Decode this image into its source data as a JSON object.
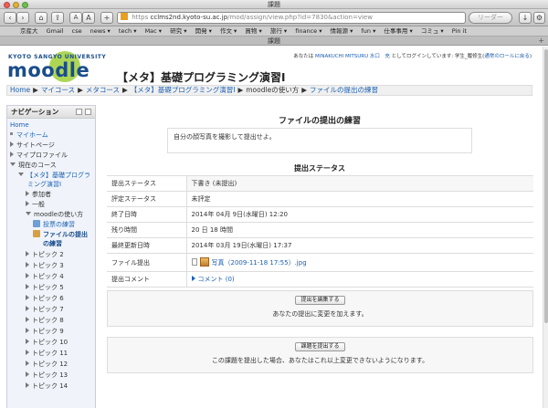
{
  "window": {
    "title": "課題",
    "tab_title": "課題"
  },
  "toolbar": {
    "url_prefix": "https",
    "url_host": "cclms2nd.kyoto-su.ac.jp",
    "url_path": "/mod/assign/view.php?id=7830&action=view",
    "reader_label": "リーダー",
    "font_small": "A",
    "font_large": "A",
    "add_label": "+"
  },
  "bookmarks": [
    "京産大",
    "Gmail",
    "cse",
    "news ▾",
    "tech ▾",
    "Mac ▾",
    "研究 ▾",
    "開発 ▾",
    "作文 ▾",
    "買物 ▾",
    "旅行 ▾",
    "finance ▾",
    "情報源 ▾",
    "fun ▾",
    "仕事事用 ▾",
    "コミュ ▾",
    "Pin it"
  ],
  "header": {
    "logo_univ": "KYOTO SANGYO UNIVERSITY",
    "logo_name": "moodle",
    "course_title": "【メタ】基礎プログラミング演習I",
    "login_prefix": "あなたは ",
    "login_user": "MINAKUCHI MITSURU 水口　充",
    "login_middle": " としてログインしています: 学生_履修生(",
    "login_role_link": "通常のロールに戻る",
    "login_suffix": ")"
  },
  "breadcrumb": [
    "Home",
    "マイコース",
    "メタコース",
    "【メタ】基礎プログラミング演習I",
    "moodleの使い方",
    "ファイルの提出の練習"
  ],
  "nav": {
    "title": "ナビゲーション",
    "home": "Home",
    "myhome": "マイホーム",
    "sitepages": "サイトページ",
    "myprofile": "マイプロファイル",
    "current_course": "現在のコース",
    "course_name_1": "【メタ】基礎プログラ",
    "course_name_2": "ミング演習I",
    "participants": "参加者",
    "general": "一般",
    "howto": "moodleの使い方",
    "vote": "投票の練習",
    "file_practice_1": "ファイルの提出",
    "file_practice_2": "の練習",
    "topics": [
      "トピック 2",
      "トピック 3",
      "トピック 4",
      "トピック 5",
      "トピック 6",
      "トピック 7",
      "トピック 8",
      "トピック 9",
      "トピック 10",
      "トピック 11",
      "トピック 12",
      "トピック 13",
      "トピック 14"
    ]
  },
  "main": {
    "title": "ファイルの提出の練習",
    "intro": "自分の顔写真を撮影して提出せよ。",
    "status_title": "提出ステータス",
    "rows": {
      "submission_status_label": "提出ステータス",
      "submission_status_value": "下書き (未提出)",
      "grading_status_label": "評定ステータス",
      "grading_status_value": "未評定",
      "due_label": "終了日時",
      "due_value": "2014年 04月 9日(水曜日) 12:20",
      "remaining_label": "残り時間",
      "remaining_value": "20 日 18 時間",
      "modified_label": "最終更新日時",
      "modified_value": "2014年 03月 19日(水曜日) 17:37",
      "files_label": "ファイル提出",
      "file_name": "写真（2009-11-18 17:55）.jpg",
      "comments_label": "提出コメント",
      "comments_link": "コメント (0)"
    },
    "edit_button": "提出を編集する",
    "edit_desc": "あなたの提出に変更を加えます。",
    "submit_button": "課題を提出する",
    "submit_desc": "この課題を提出した場合、あなたはこれ以上変更できないようになります。"
  },
  "colors": {
    "link": "#1a5fb4",
    "logo_green": "#9fcf3a",
    "logo_blue": "#1a4d8c"
  }
}
